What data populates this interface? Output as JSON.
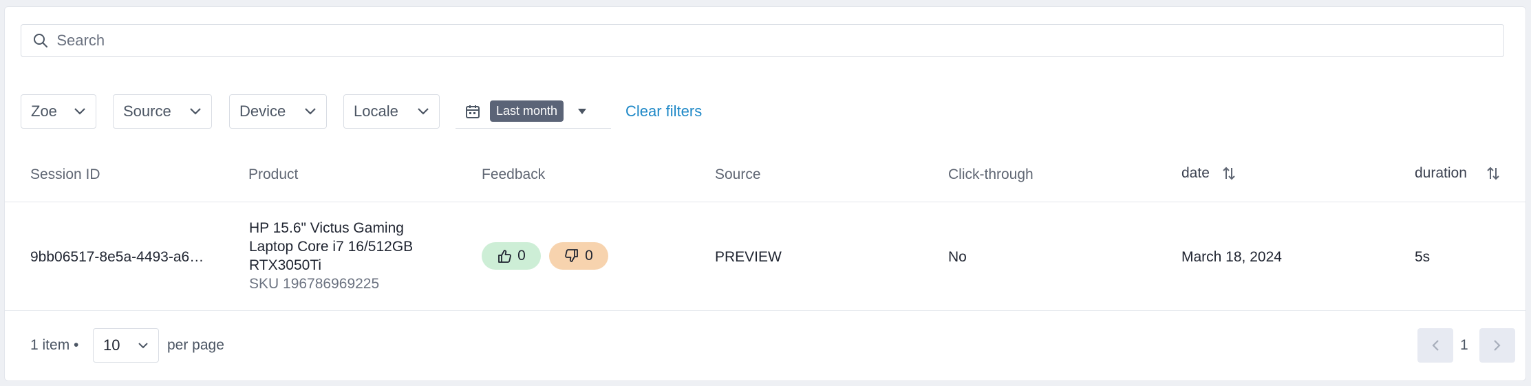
{
  "search": {
    "placeholder": "Search"
  },
  "filters": {
    "items": [
      "Zoe",
      "Source",
      "Device",
      "Locale"
    ],
    "date_badge": "Last month",
    "clear_label": "Clear filters"
  },
  "table": {
    "columns": [
      "Session ID",
      "Product",
      "Feedback",
      "Source",
      "Click-through",
      "date",
      "duration"
    ],
    "rows": [
      {
        "session_id": "9bb06517-8e5a-4493-a6…",
        "product_line1": "HP 15.6\" Victus Gaming",
        "product_line2": "Laptop Core i7 16/512GB",
        "product_line3": "RTX3050Ti",
        "sku": "SKU 196786969225",
        "thumbs_up": "0",
        "thumbs_down": "0",
        "source": "PREVIEW",
        "click_through": "No",
        "date": "March 18, 2024",
        "duration": "5s"
      }
    ]
  },
  "footer": {
    "item_count": "1 item •",
    "per_page_value": "10",
    "per_page_label": "per page",
    "page": "1"
  },
  "colors": {
    "accent_link": "#1e88c7",
    "badge_bg": "#5b6477",
    "thumbs_up_bg": "#cdeed6",
    "thumbs_down_bg": "#f7d3ae"
  }
}
